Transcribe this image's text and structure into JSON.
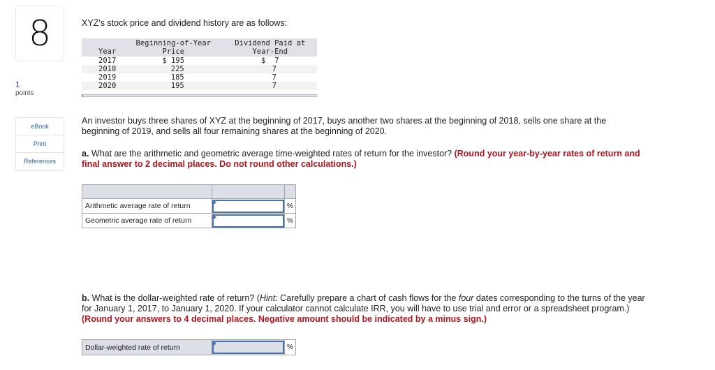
{
  "question": {
    "number": "8",
    "points_value": "1",
    "points_label": "points"
  },
  "side_links": [
    {
      "label": "eBook"
    },
    {
      "label": "Print"
    },
    {
      "label": "References"
    }
  ],
  "intro": "XYZ's stock price and dividend history are as follows:",
  "data_table": {
    "headers": {
      "year": "Year",
      "price_line1": "Beginning-of-Year",
      "price_line2": "Price",
      "div_line1": "Dividend Paid at",
      "div_line2": "Year-End"
    },
    "rows": [
      {
        "year": "2017",
        "price": "$ 195",
        "dividend": "$  7"
      },
      {
        "year": "2018",
        "price": "225",
        "dividend": "7"
      },
      {
        "year": "2019",
        "price": "185",
        "dividend": "7"
      },
      {
        "year": "2020",
        "price": "195",
        "dividend": "7"
      }
    ]
  },
  "scenario": "An investor buys three shares of XYZ at the beginning of 2017, buys another two shares at the beginning of 2018, sells one share at the beginning of 2019, and sells all four remaining shares at the beginning of 2020.",
  "part_a": {
    "lead": "a.",
    "text": " What are the arithmetic and geometric average time-weighted rates of return for the investor? ",
    "instruction": "(Round your year-by-year rates of return and final answer to 2 decimal places. Do not round other calculations.)",
    "rows": [
      {
        "label": "Arithmetic average rate of return",
        "value": "",
        "unit": "%"
      },
      {
        "label": "Geometric average rate of return",
        "value": "",
        "unit": "%"
      }
    ]
  },
  "part_b": {
    "lead": "b.",
    "text1": " What is the dollar-weighted rate of return? (",
    "hint_label": "Hint:",
    "text2": " Carefully prepare a chart of cash flows for the ",
    "emph": "four",
    "text3": " dates corresponding to the turns of the year for January 1, 2017, to January 1, 2020. If your calculator cannot calculate IRR, you will have to use trial and error or a spreadsheet program.) ",
    "instruction": "(Round your answers to 4 decimal places. Negative amount should be indicated by a minus sign.)",
    "row": {
      "label": "Dollar-weighted rate of return",
      "value": "",
      "unit": "%"
    }
  }
}
